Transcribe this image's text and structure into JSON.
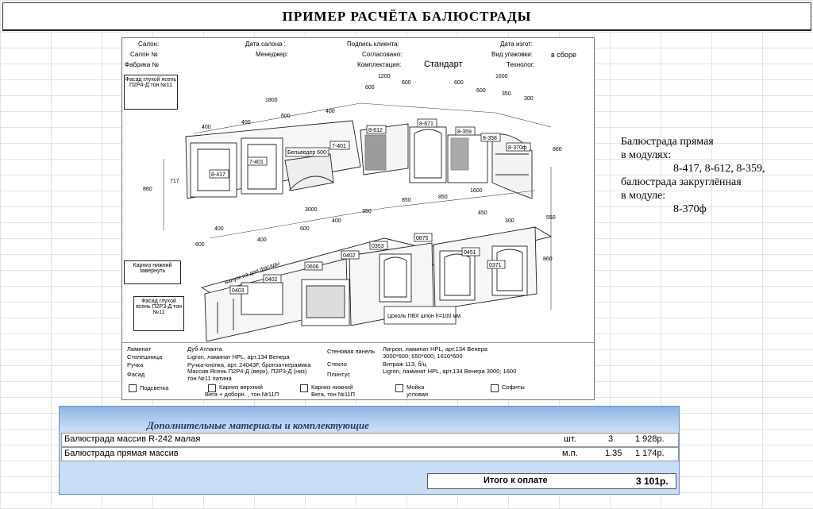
{
  "title": "ПРИМЕР  РАСЧЁТА  БАЛЮСТРАДЫ",
  "sheet_header": {
    "salon": "Салон:",
    "salon_no": "Салон №",
    "factory_no": "Фабрика №",
    "salon_date": "Дата салона :",
    "manager": "Менеджер:",
    "client_sign": "Подпись клиента:",
    "agreed": "Согласовано:",
    "kit": "Комплектация:",
    "kit_value": "Стандарт",
    "make_date": "Дата изгот:",
    "pack_type": "Вид упаковки:",
    "pack_value": "в сборе",
    "technologist": "Технолог:"
  },
  "drawing": {
    "dims": [
      "1800",
      "400",
      "400",
      "600",
      "400",
      "1200",
      "600",
      "600",
      "600",
      "600",
      "350",
      "300",
      "1600",
      "717",
      "860",
      "3000",
      "400",
      "600",
      "400",
      "350",
      "850",
      "850",
      "1600",
      "450",
      "300",
      "860",
      "550",
      "860",
      "400",
      "600"
    ],
    "tags": [
      "8-417",
      "7-401",
      "8-612",
      "8-671",
      "8-359",
      "8-358",
      "8-370ф",
      "7-401",
      "0875",
      "0353",
      "0402",
      "0606",
      "0402",
      "0403",
      "0451",
      "0371"
    ],
    "callouts": {
      "facade_top": "Фасад глухой ясень П2Р4-Д тон №11",
      "cornice_low": "Карниз нижний завернуть",
      "facade_bottom": "Фасад глухой ясень П2Р3-Д тон №11",
      "hood": "Бельведер 600",
      "overlap": "напуск на доп.фасады",
      "plinth": "Цоколь ПВХ шпон h=100 мм"
    }
  },
  "spec": {
    "laminate_label": "Ламинат",
    "laminate_value": "Дуб Атланта",
    "top_label": "Столешница",
    "top_value": "Ligron, ламинат HPL, арт.134 Венера",
    "handle_label": "Ручка",
    "handle_value": "Ручка-кнопка, арт. 24043F, бронза+керамика",
    "facade_label": "Фасад",
    "facade_value": "Массив Ясень П2Р4-Д (верх), П2Р3-Д (низ)",
    "facade_value2": "тон №11 патина",
    "wall_label": "Стеновая панель",
    "wall_value": "Лигрон, ламинат HPL, арт.134 Венера",
    "wall_value2": "3000*600; 650*600; 1610*600",
    "glass_label": "Стекло",
    "glass_value": "Витраж 113, б/ц",
    "plinth_label": "Плинтус",
    "plinth_value": "Ligron, ламинат HPL, арт.134 Венера 3000; 1600",
    "options": [
      "Подсветка",
      "Карниз верхний",
      "Карниз нижний",
      "Мойка",
      "Софиты"
    ],
    "options_sub": [
      "Вега + доборн. , тон №11П",
      "Вега, тон №11П",
      "угловая"
    ]
  },
  "note": {
    "line1": "Балюстрада прямая",
    "line2": "в модулях:",
    "line3": "8-417, 8-612, 8-359,",
    "line4": "балюстрада закруглённая",
    "line5": "в модуле:",
    "line6": "8-370ф"
  },
  "materials": {
    "title": "Дополнительные материалы и комплектующие",
    "rows": [
      {
        "name": "Балюстрада массив R-242 малая",
        "unit": "шт.",
        "qty": "3",
        "price": "1 928р."
      },
      {
        "name": "Балюстрада прямая массив",
        "unit": "м.п.",
        "qty": "1.35",
        "price": "1 174р."
      }
    ],
    "total_label": "Итого к оплате",
    "total_value": "3 101р."
  }
}
